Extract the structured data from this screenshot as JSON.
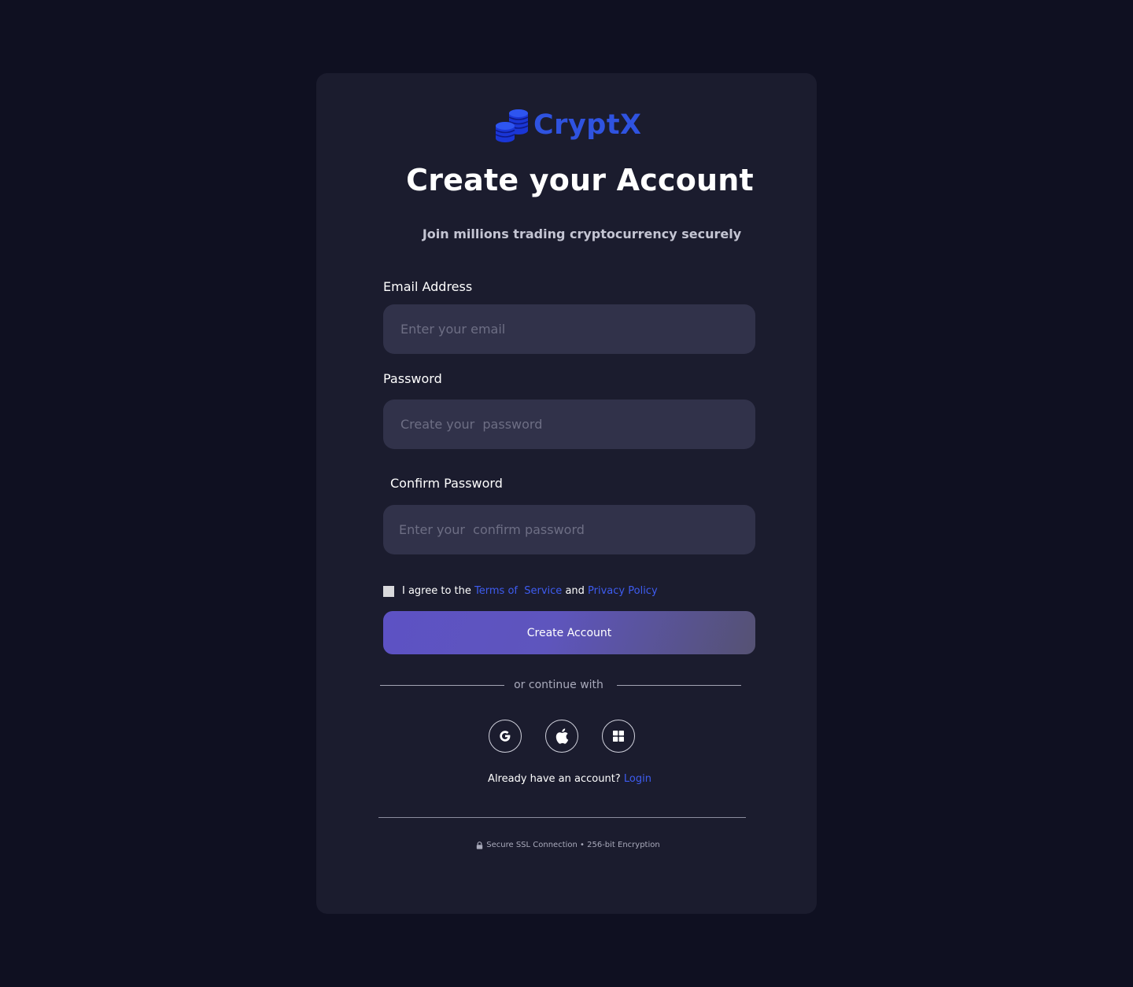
{
  "brand": {
    "name": "CryptX",
    "icon": "coins-stack-icon",
    "color": "#2f53e0"
  },
  "header": {
    "title": "Create your Account",
    "subtitle": "Join millions trading cryptocurrency securely"
  },
  "form": {
    "email": {
      "label": "Email Address",
      "placeholder": "Enter your email",
      "value": ""
    },
    "password": {
      "label": "Password",
      "placeholder": "Create your  password",
      "value": ""
    },
    "confirm_password": {
      "label": "Confirm Password",
      "placeholder": "Enter your  confirm password",
      "value": ""
    },
    "agree": {
      "checked": false,
      "prefix": "I agree to the",
      "terms_link": "Terms of  Service",
      "conjunction": "and",
      "privacy_link": "Privacy Policy"
    },
    "submit_label": "Create Account"
  },
  "social": {
    "divider_text": "or continue with",
    "providers": [
      {
        "icon": "google-icon"
      },
      {
        "icon": "apple-icon"
      },
      {
        "icon": "windows-icon"
      }
    ]
  },
  "login": {
    "prompt": "Already have an account?",
    "link": "Login"
  },
  "footer": {
    "security_text": "Secure SSL Connection • 256-bit Encryption",
    "icon": "lock-icon"
  },
  "colors": {
    "background": "#0f1021",
    "card": "#1b1c2e",
    "input": "#31324a",
    "link": "#3e5cf0",
    "button_gradient_start": "#5d52c4",
    "button_gradient_end": "#555273"
  }
}
